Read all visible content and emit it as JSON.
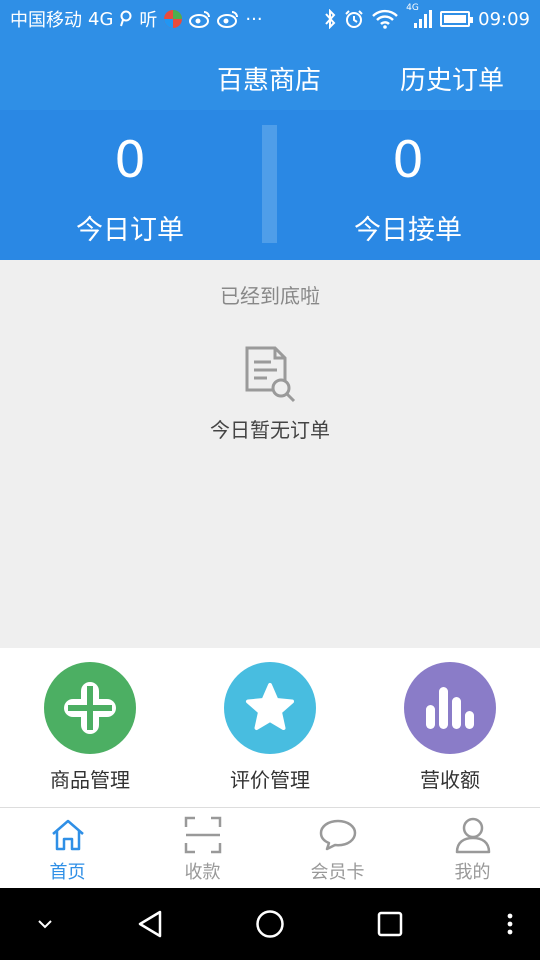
{
  "status_bar": {
    "carrier": "中国移动",
    "network": "4G",
    "app_label": "听",
    "more": "···",
    "time": "09:09",
    "signal_label": "4G"
  },
  "header": {
    "store_name": "百惠商店",
    "history_orders": "历史订单"
  },
  "stats": {
    "today_orders": {
      "value": "0",
      "label": "今日订单"
    },
    "today_accepted": {
      "value": "0",
      "label": "今日接单"
    }
  },
  "content": {
    "bottom_hint": "已经到底啦",
    "empty_text": "今日暂无订单"
  },
  "quick_actions": [
    {
      "label": "商品管理",
      "color": "#4caf63",
      "icon": "plus-cross-icon"
    },
    {
      "label": "评价管理",
      "color": "#48bde0",
      "icon": "star-icon"
    },
    {
      "label": "营收额",
      "color": "#8a7cc8",
      "icon": "bar-chart-icon"
    }
  ],
  "tabs": [
    {
      "label": "首页",
      "icon": "home-icon",
      "active": true
    },
    {
      "label": "收款",
      "icon": "scan-icon",
      "active": false
    },
    {
      "label": "会员卡",
      "icon": "chat-bubble-icon",
      "active": false
    },
    {
      "label": "我的",
      "icon": "user-icon",
      "active": false
    }
  ],
  "colors": {
    "primary": "#2f8fe6",
    "inactive_tab": "#999999"
  }
}
